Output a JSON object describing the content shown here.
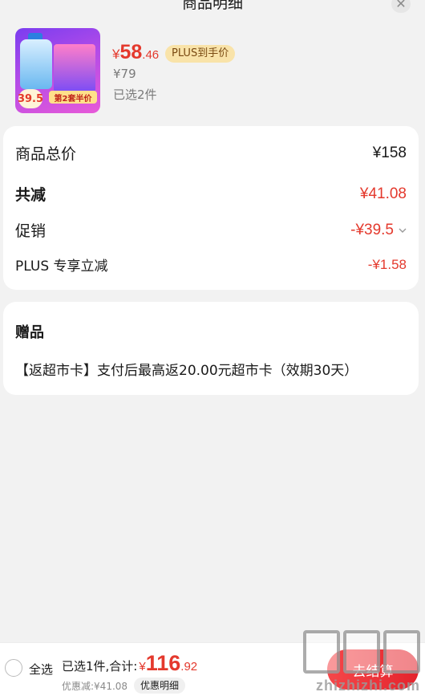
{
  "header": {
    "title": "商品明细",
    "close_icon": "close-icon"
  },
  "product": {
    "thumbnail": {
      "badge_price": "39.5",
      "half_price_tag": "第2套半价"
    },
    "price_yen": "¥",
    "price_int": "58",
    "price_dec": ".46",
    "plus_tag": "PLUS到手价",
    "original_price": "¥79",
    "selected_count": "已选2件"
  },
  "summary": {
    "total_label": "商品总价",
    "total_value": "¥158",
    "reduce_label": "共减",
    "reduce_value": "¥41.08",
    "promo_label": "促销",
    "promo_value": "-¥39.5",
    "plus_label": "PLUS 专享立减",
    "plus_value": "-¥1.58"
  },
  "gift": {
    "title": "赠品",
    "text": "【返超市卡】支付后最高返20.00元超市卡（效期30天）"
  },
  "bottom_bar": {
    "select_all": "全选",
    "summary_prefix": "已选1件,合计:",
    "total_yen": "¥",
    "total_int": "116",
    "total_dec": ".92",
    "discount_text": "优惠减:¥41.08",
    "detail_button": "优惠明细",
    "checkout_button": "去结算"
  },
  "watermark": {
    "text": "zhizhizhi.com"
  },
  "colors": {
    "accent_red": "#e4392d",
    "plus_gold": "#f9e3a9",
    "background": "#f2f2f2"
  }
}
